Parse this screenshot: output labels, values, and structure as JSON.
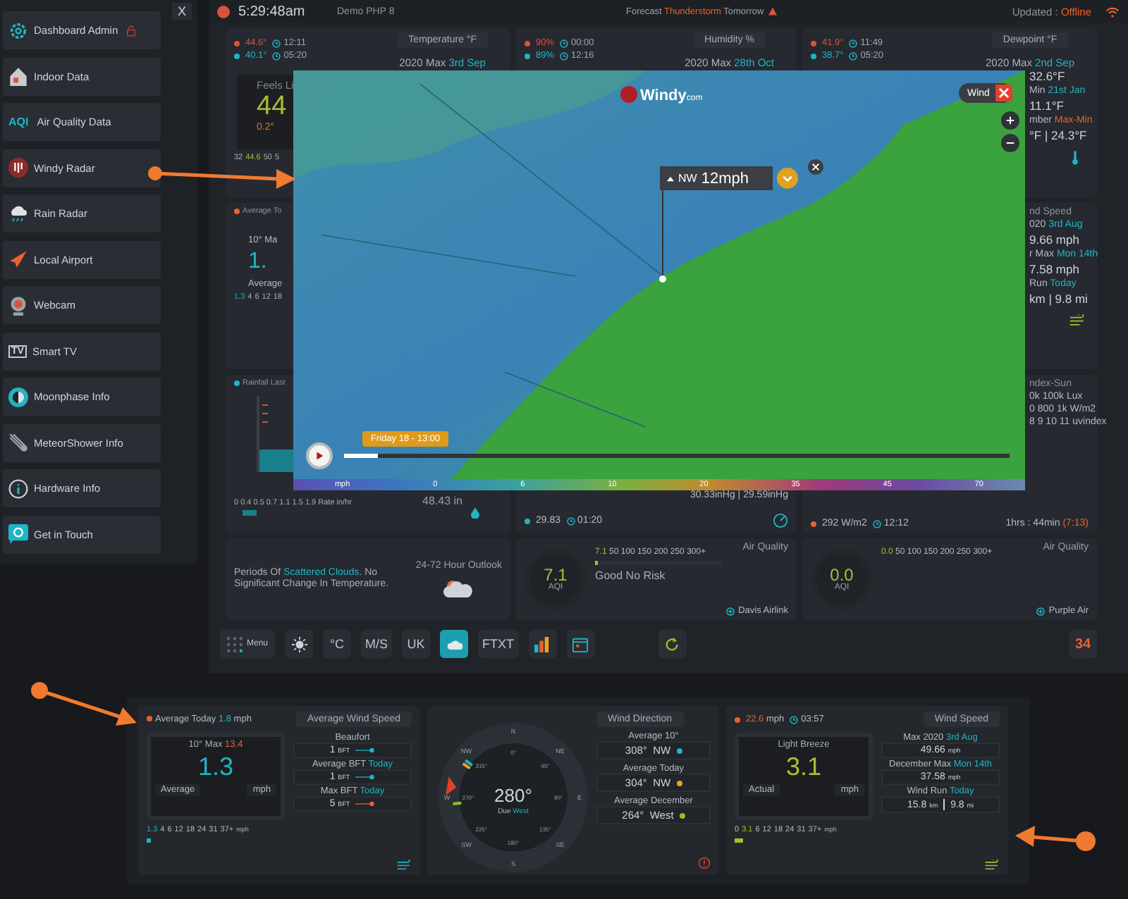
{
  "topbar": {
    "time": "5:29:48am",
    "location": "Demo PHP 8",
    "forecast_label": "Forecast",
    "forecast_highlight": "Thunderstorm",
    "forecast_suffix": "Tomorrow",
    "updated_label": "Updated :",
    "updated_status": "Offline"
  },
  "sidebar": {
    "close": "X",
    "items": [
      {
        "label": "Dashboard Admin",
        "kind": "gear"
      },
      {
        "label": "Indoor Data",
        "kind": "house"
      },
      {
        "label": "Air Quality Data",
        "kind": "badge",
        "badge": "AQI"
      },
      {
        "label": "Windy Radar",
        "kind": "windy"
      },
      {
        "label": "Rain Radar",
        "kind": "rain"
      },
      {
        "label": "Local Airport",
        "kind": "plane"
      },
      {
        "label": "Webcam",
        "kind": "webcam"
      },
      {
        "label": "Smart TV",
        "kind": "tv",
        "badge": "TV"
      },
      {
        "label": "Moonphase Info",
        "kind": "moon"
      },
      {
        "label": "MeteorShower Info",
        "kind": "meteor"
      },
      {
        "label": "Hardware Info",
        "kind": "info"
      },
      {
        "label": "Get in Touch",
        "kind": "at"
      }
    ]
  },
  "temperature": {
    "readings": [
      {
        "value": "44.6°",
        "time": "12:11",
        "color": "#d9533a"
      },
      {
        "value": "40.1°",
        "time": "05:20",
        "color": "#1fb5c4"
      }
    ],
    "title": "Temperature °F",
    "max_label": "2020 Max",
    "max_highlight": "3rd Sep",
    "gauge_label": "Feels Li",
    "gauge_value": "44",
    "trend": "0.2°",
    "scale": [
      {
        "text": "32",
        "current": false
      },
      {
        "text": "44.6",
        "current": true
      },
      {
        "text": "50",
        "current": false
      },
      {
        "text": "5",
        "current": false
      }
    ]
  },
  "humidity": {
    "readings": [
      {
        "value": "90%",
        "time": "00:00",
        "color": "#d9533a"
      },
      {
        "value": "89%",
        "time": "12:16",
        "color": "#1fb5c4"
      }
    ],
    "title": "Humidity %",
    "max_label": "2020 Max",
    "max_highlight": "28th Oct"
  },
  "dewpoint": {
    "readings": [
      {
        "value": "41.9°",
        "time": "11:49",
        "color": "#d9533a"
      },
      {
        "value": "38.7°",
        "time": "05:20",
        "color": "#1fb5c4"
      }
    ],
    "title": "Dewpoint °F",
    "max_label": "2020 Max",
    "max_highlight": "2nd Sep",
    "lines": [
      {
        "text": "32.6°F",
        "kind": "value"
      },
      {
        "text": "Min",
        "highlight": "21st Jan",
        "color": "#1fb5c4",
        "kind": "label"
      },
      {
        "text": "11.1°F",
        "kind": "value"
      },
      {
        "text": "mber",
        "highlight": "Max-Min",
        "color": "#e8632a",
        "kind": "label"
      },
      {
        "text": "°F | 24.3°F",
        "kind": "value"
      }
    ]
  },
  "average_wind": {
    "title": "Average To",
    "lines": [
      {
        "text": "10° Ma",
        "kind": "label"
      },
      {
        "text": "1.",
        "kind": "big"
      },
      {
        "text": "Average",
        "kind": "label"
      }
    ],
    "scale": [
      {
        "text": "1.3",
        "current": true
      },
      {
        "text": "4",
        "current": false
      },
      {
        "text": "6",
        "current": false
      },
      {
        "text": "12",
        "current": false
      },
      {
        "text": "18",
        "current": false
      }
    ]
  },
  "wind_speed": {
    "lines": [
      {
        "text": "nd Speed",
        "kind": "title"
      },
      {
        "text": "020",
        "highlight": "3rd Aug",
        "color": "#1fb5c4",
        "kind": "label"
      },
      {
        "text": "9.66 mph",
        "kind": "value"
      },
      {
        "text": "r Max",
        "highlight": "Mon 14th",
        "color": "#1fb5c4",
        "kind": "label"
      },
      {
        "text": "7.58 mph",
        "kind": "value"
      },
      {
        "text": "Run",
        "highlight": "Today",
        "color": "#1fb5c4",
        "kind": "label"
      },
      {
        "text": "km | 9.8 mi",
        "kind": "value"
      }
    ]
  },
  "rainfall": {
    "title": "Rainfall Last",
    "scale": "0 0.4 0.5 0.7 1.1 1.5 1.9",
    "scale_unit": "Rate in/hr",
    "total": "48.43 in"
  },
  "pressure": {
    "reading": "30.33inHg | 29.59inHg",
    "value": "29.83",
    "time": "01:20"
  },
  "solar": {
    "lines": [
      {
        "text": "ndex-Sun",
        "kind": "title"
      },
      {
        "text": "0k 100k Lux",
        "kind": "label"
      },
      {
        "text": "0 800 1k W/m2",
        "kind": "label"
      },
      {
        "text": "8 9 10 11 uvindex",
        "kind": "label"
      }
    ],
    "radiation": "292 W/m2",
    "time": "12:12",
    "daylight": "1hrs : 44min",
    "daylight_time": "(7:13)"
  },
  "outlook": {
    "title": "24-72 Hour Outlook",
    "text_before": "Periods Of",
    "highlight": "Scattered Clouds",
    "text_after": ". No Significant Change In Temperature."
  },
  "air_quality": [
    {
      "title": "Air Quality",
      "value": "7.1",
      "unit": "AQI",
      "scale_value": "7.1",
      "scale": "50 100 150 200 250 300+",
      "level": 0.02,
      "status": "Good No Risk",
      "source": "Davis Airlink"
    },
    {
      "title": "Air Quality",
      "value": "0.0",
      "unit": "AQI",
      "scale_value": "0.0",
      "scale": "50 100 150 200 250 300+",
      "source": "Purple Air"
    }
  ],
  "toolbar": [
    {
      "kind": "menu",
      "label": "Menu",
      "selected": false
    },
    {
      "kind": "sun",
      "selected": false
    },
    {
      "kind": "text",
      "label": "°C",
      "selected": false
    },
    {
      "kind": "text",
      "label": "M/S",
      "selected": false
    },
    {
      "kind": "text",
      "label": "UK",
      "selected": false
    },
    {
      "kind": "cloud",
      "selected": true
    },
    {
      "kind": "text",
      "label": "FTXT",
      "selected": false
    },
    {
      "kind": "chart",
      "selected": false
    },
    {
      "kind": "calendar",
      "selected": false
    },
    {
      "kind": "refresh",
      "selected": false
    },
    {
      "kind": "date",
      "label": "34",
      "selected": false
    }
  ],
  "map": {
    "logo": "Windy",
    "logo_suffix": "com",
    "layer_button": "Wind",
    "popup_direction": "NW",
    "popup_speed": "12mph",
    "time_label": "Friday 18 - 13:00",
    "level": 0.05,
    "legend": [
      "mph",
      "0",
      "6",
      "10",
      "20",
      "35",
      "45",
      "70"
    ]
  },
  "average_panel": {
    "dot_label": "Average Today",
    "dot_value": "1.8",
    "dot_unit": "mph",
    "title": "Average Wind Speed",
    "top_label": "10° Max",
    "top_value": "13.4",
    "value": "1.3",
    "left": "Average",
    "right": "mph",
    "scale": [
      {
        "text": "1.3",
        "current": true
      },
      {
        "text": "4",
        "current": false
      },
      {
        "text": "6",
        "current": false
      },
      {
        "text": "12",
        "current": false
      },
      {
        "text": "18",
        "current": false
      },
      {
        "text": "24",
        "current": false
      },
      {
        "text": "31",
        "current": false
      },
      {
        "text": "37+",
        "current": false
      }
    ],
    "scale_unit": "mph",
    "level": 0.03,
    "bft": [
      {
        "label": "Beaufort",
        "value": "1",
        "unit": "BFT",
        "color": "#1fb5c4"
      },
      {
        "label": "Average BFT",
        "highlight": "Today",
        "value": "1",
        "unit": "BFT",
        "color": "#1fb5c4"
      },
      {
        "label": "Max BFT",
        "highlight": "Today",
        "value": "5",
        "unit": "BFT",
        "color": "#e8632a"
      }
    ]
  },
  "compass": {
    "points": [
      "N",
      "NE",
      "E",
      "SE",
      "S",
      "SW",
      "W",
      "NW"
    ],
    "degrees": [
      "0°",
      "45°",
      "90°",
      "135°",
      "180°",
      "225°",
      "270°",
      "315°"
    ],
    "bearing": "280°",
    "label": "Due",
    "label_highlight": "West"
  },
  "direction_panel": {
    "title": "Wind Direction",
    "rows": [
      {
        "label": "Average 10°",
        "value": "308°",
        "dir": "NW",
        "color": "#1fb5c4"
      },
      {
        "label": "Average Today",
        "value": "304°",
        "dir": "NW",
        "color": "#f0a020"
      },
      {
        "label": "Average December",
        "value": "264°",
        "dir": "West",
        "color": "#8fc31f"
      }
    ]
  },
  "speed_panel": {
    "dot_value": "22.6",
    "dot_unit": "mph",
    "time": "03:57",
    "title": "Wind Speed",
    "top_label": "Light Breeze",
    "value": "3.1",
    "left": "Actual",
    "right": "mph",
    "scale": [
      {
        "text": "0",
        "current": false
      },
      {
        "text": "3.1",
        "current": true
      },
      {
        "text": "6",
        "current": false
      },
      {
        "text": "12",
        "current": false
      },
      {
        "text": "18",
        "current": false
      },
      {
        "text": "24",
        "current": false
      },
      {
        "text": "31",
        "current": false
      },
      {
        "text": "37+",
        "current": false
      }
    ],
    "scale_unit": "mph",
    "level": 0.06,
    "rows": [
      {
        "label": "Max 2020",
        "highlight": "3rd Aug",
        "value": "49.66",
        "unit": "mph"
      },
      {
        "label": "December Max",
        "highlight": "Mon 14th",
        "value": "37.58",
        "unit": "mph"
      },
      {
        "label": "Wind Run",
        "highlight": "Today",
        "value": "15.8",
        "unit": "km",
        "value2": "9.8",
        "unit2": "mi"
      }
    ]
  }
}
